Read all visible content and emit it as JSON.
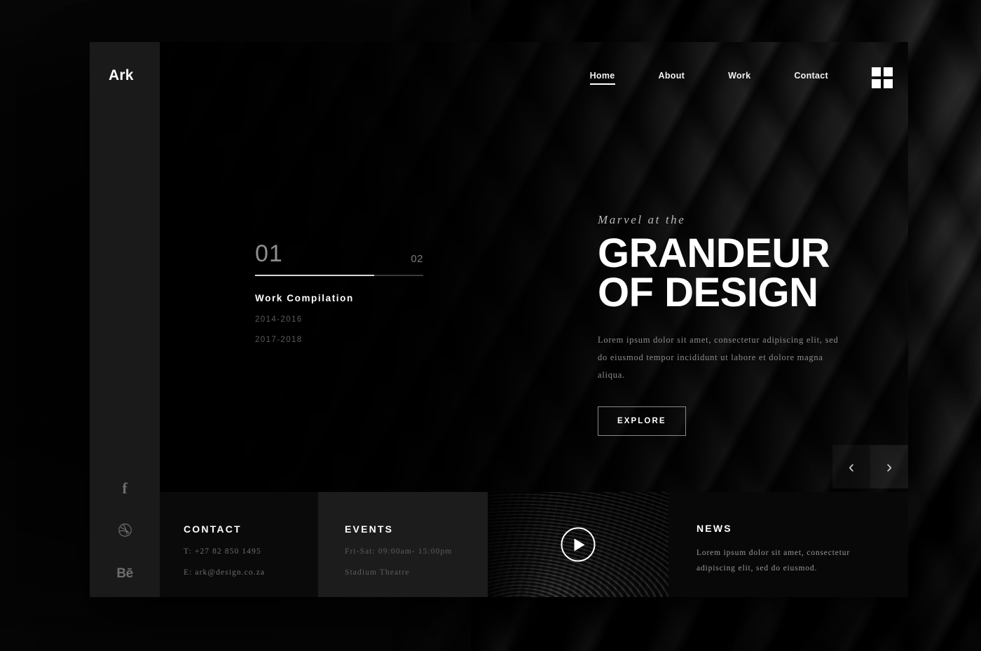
{
  "brand": {
    "logo": "Ark"
  },
  "nav": {
    "items": [
      {
        "label": "Home",
        "active": true
      },
      {
        "label": "About",
        "active": false
      },
      {
        "label": "Work",
        "active": false
      },
      {
        "label": "Contact",
        "active": false
      }
    ],
    "grid_menu_icon": "grid-menu-icon"
  },
  "social": [
    {
      "name": "facebook",
      "glyph": "f"
    },
    {
      "name": "dribbble",
      "glyph": "●"
    },
    {
      "name": "behance",
      "glyph": "Bē"
    }
  ],
  "work": {
    "current_index": "01",
    "total_index": "02",
    "progress_percent": 71,
    "title": "Work Compilation",
    "years": [
      "2014-2016",
      "2017-2018"
    ]
  },
  "hero": {
    "eyebrow": "Marvel at the",
    "headline_line1": "GRANDEUR",
    "headline_line2": "OF DESIGN",
    "paragraph": "Lorem ipsum dolor sit amet, consectetur adipiscing elit, sed do eiusmod tempor incididunt ut labore et dolore magna aliqua.",
    "cta_label": "EXPLORE"
  },
  "carousel": {
    "prev_label": "‹",
    "next_label": "›"
  },
  "footer": {
    "contact": {
      "heading": "CONTACT",
      "phone": "T: +27 82 850 1495",
      "email": "E: ark@design.co.za"
    },
    "events": {
      "heading": "EVENTS",
      "hours": "Fri-Sat: 09:00am- 15:00pm",
      "venue": "Stadium Theatre"
    },
    "video": {
      "play_icon": "play-icon"
    },
    "news": {
      "heading": "NEWS",
      "body": "Lorem ipsum dolor sit amet, consectetur adipiscing elit, sed do eiusmod."
    }
  },
  "colors": {
    "page_background": "#121212",
    "window_background": "#0a0a0a",
    "rail_background": "#1a1a1a",
    "events_card": "#1c1c1c",
    "text_primary": "#ffffff",
    "text_muted": "#8d8d8d",
    "text_dim": "#5c5c5c",
    "accent_line": "#d8d8d8"
  }
}
